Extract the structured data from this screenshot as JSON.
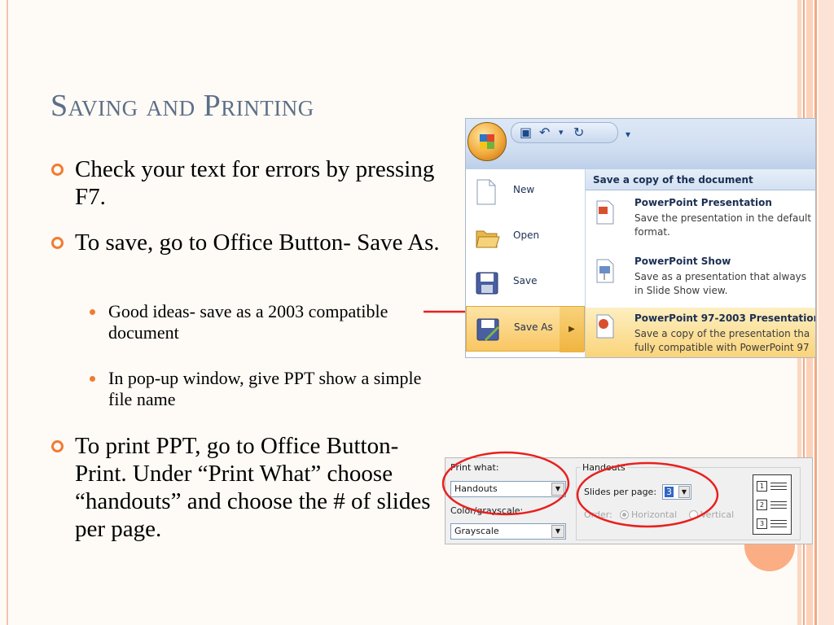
{
  "slide": {
    "title": "Saving and Printing",
    "bullets": [
      "Check your text for errors by pressing F7.",
      "To save, go to Office Button- Save As.",
      "To print PPT, go to Office Button- Print. Under “Print What” choose “handouts” and choose the # of slides per page."
    ],
    "sub_bullets": [
      "Good ideas- save as a 2003 compatible document",
      "In pop-up window, give PPT show a simple file name"
    ],
    "accent_color": "#f07c32",
    "title_color": "#5c6f87",
    "arrow_color": "#e8201f"
  },
  "office_menu": {
    "left_items": [
      {
        "label": "New",
        "icon": "new-document-icon"
      },
      {
        "label": "Open",
        "icon": "open-folder-icon"
      },
      {
        "label": "Save",
        "icon": "save-disk-icon"
      },
      {
        "label": "Save As",
        "icon": "save-as-icon"
      }
    ],
    "submenu_header": "Save a copy of the document",
    "options": [
      {
        "title": "PowerPoint Presentation",
        "desc1": "Save the presentation in the default",
        "desc2": "format."
      },
      {
        "title": "PowerPoint Show",
        "desc1": "Save as a presentation that always",
        "desc2": "in Slide Show view."
      },
      {
        "title": "PowerPoint 97-2003 Presentation",
        "desc1": "Save a copy of the presentation tha",
        "desc2": "fully compatible with PowerPoint 97"
      }
    ]
  },
  "print_dialog": {
    "print_what_label": "Print what:",
    "print_what_value": "Handouts",
    "color_label": "Color/grayscale:",
    "color_value": "Grayscale",
    "handouts_group": "Handouts",
    "slides_per_page_label": "Slides per page:",
    "slides_per_page_value": "3",
    "order_label": "Order:",
    "order_horizontal": "Horizontal",
    "order_vertical": "Vertical",
    "preview_numbers": [
      "1",
      "2",
      "3"
    ]
  }
}
